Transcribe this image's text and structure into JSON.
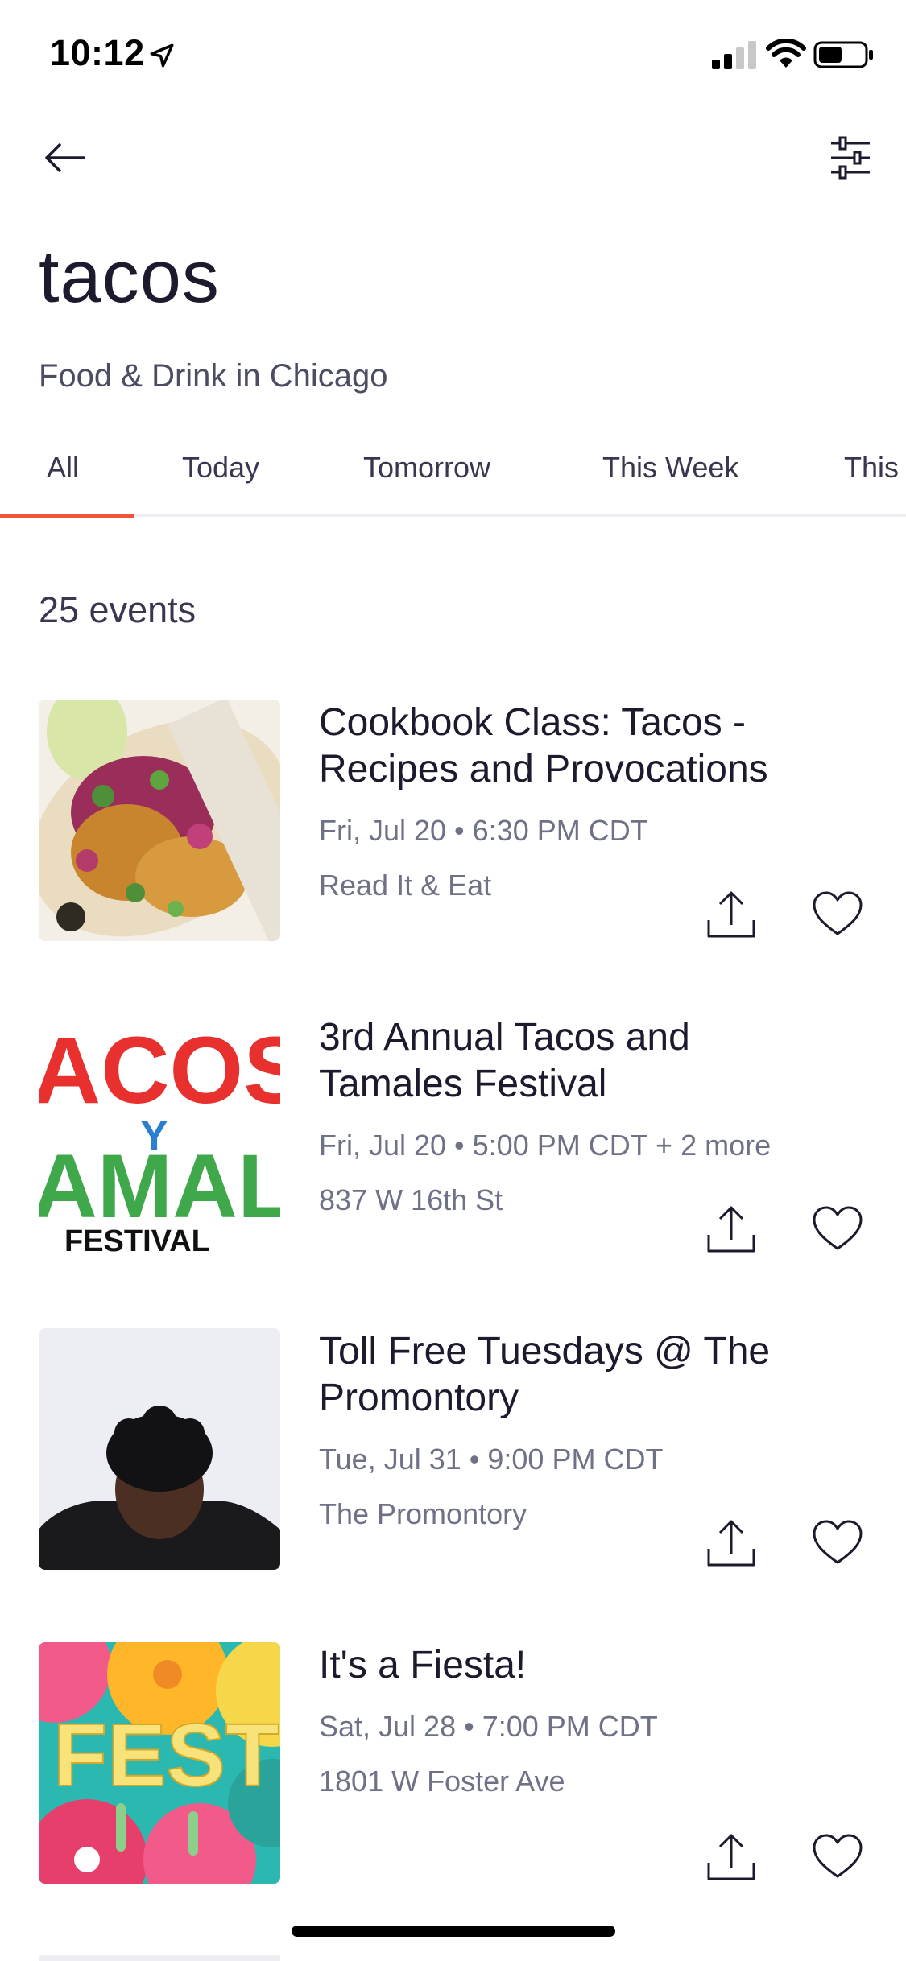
{
  "status_bar": {
    "time": "10:12",
    "icons": [
      "location-arrow-icon",
      "cellular-signal-icon",
      "wifi-icon",
      "battery-icon"
    ]
  },
  "nav": {
    "back_icon": "arrow-left-icon",
    "filter_icon": "sliders-icon"
  },
  "search": {
    "query": "tacos",
    "subtitle": "Food & Drink in Chicago"
  },
  "tabs": [
    {
      "label": "All",
      "active": true
    },
    {
      "label": "Today",
      "active": false
    },
    {
      "label": "Tomorrow",
      "active": false
    },
    {
      "label": "This Week",
      "active": false
    },
    {
      "label": "This",
      "active": false
    }
  ],
  "results": {
    "count_label": "25 events"
  },
  "events": [
    {
      "title": "Cookbook Class: Tacos - Recipes and Provocations",
      "datetime": "Fri, Jul 20 • 6:30 PM CDT",
      "venue": "Read It & Eat"
    },
    {
      "title": "3rd Annual Tacos and Tamales Festival",
      "datetime": "Fri, Jul 20 • 5:00 PM CDT + 2 more",
      "venue": "837 W 16th St",
      "image_text": {
        "line1": "ACOS",
        "line2": "Y",
        "line3": "AMAL",
        "line4": "FESTIVAL"
      }
    },
    {
      "title": "Toll Free Tuesdays @ The Promontory",
      "datetime": "Tue, Jul 31 • 9:00 PM CDT",
      "venue": "The Promontory"
    },
    {
      "title": "It's a Fiesta!",
      "datetime": "Sat, Jul 28 • 7:00 PM CDT",
      "venue": "1801 W Foster Ave",
      "image_text": "FEST"
    }
  ],
  "colors": {
    "accent": "#f05537",
    "text_primary": "#1e1a2e",
    "text_secondary": "#6f7287"
  }
}
